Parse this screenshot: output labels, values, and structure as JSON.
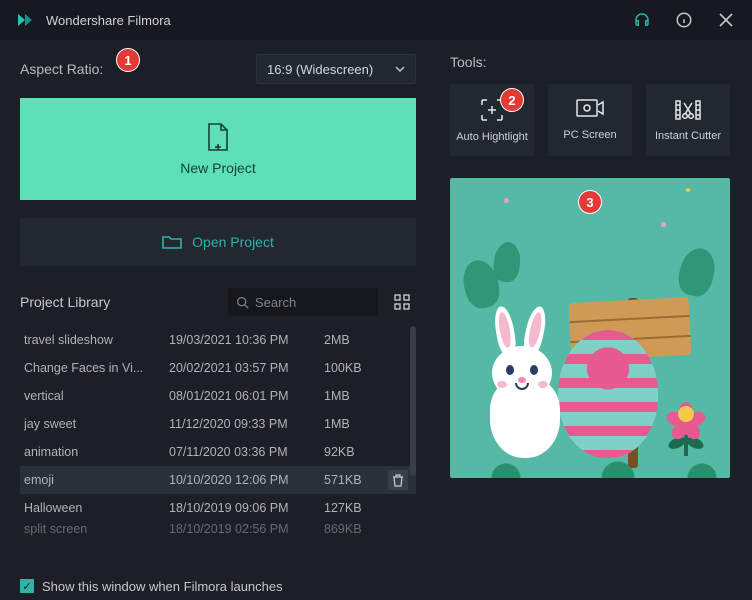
{
  "titlebar": {
    "title": "Wondershare Filmora"
  },
  "left": {
    "aspect_label": "Aspect Ratio:",
    "aspect_value": "16:9 (Widescreen)",
    "new_project": "New Project",
    "open_project": "Open Project",
    "library_label": "Project Library",
    "search_placeholder": "Search"
  },
  "library": {
    "items": [
      {
        "name": "travel slideshow",
        "date": "19/03/2021 10:36 PM",
        "size": "2MB"
      },
      {
        "name": "Change Faces in Vi...",
        "date": "20/02/2021 03:57 PM",
        "size": "100KB"
      },
      {
        "name": "vertical",
        "date": "08/01/2021 06:01 PM",
        "size": "1MB"
      },
      {
        "name": "jay sweet",
        "date": "11/12/2020 09:33 PM",
        "size": "1MB"
      },
      {
        "name": "animation",
        "date": "07/11/2020 03:36 PM",
        "size": "92KB"
      },
      {
        "name": "emoji",
        "date": "10/10/2020 12:06 PM",
        "size": "571KB"
      },
      {
        "name": "Halloween",
        "date": "18/10/2019 09:06 PM",
        "size": "127KB"
      },
      {
        "name": "split screen",
        "date": "18/10/2019 02:56 PM",
        "size": "869KB"
      }
    ],
    "selected_index": 5
  },
  "right": {
    "tools_label": "Tools:",
    "tools": [
      {
        "label": "Auto Hightlight"
      },
      {
        "label": "PC Screen"
      },
      {
        "label": "Instant Cutter"
      }
    ]
  },
  "badges": {
    "b1": "1",
    "b2": "2",
    "b3": "3"
  },
  "footer": {
    "show_window": "Show this window when Filmora launches"
  }
}
